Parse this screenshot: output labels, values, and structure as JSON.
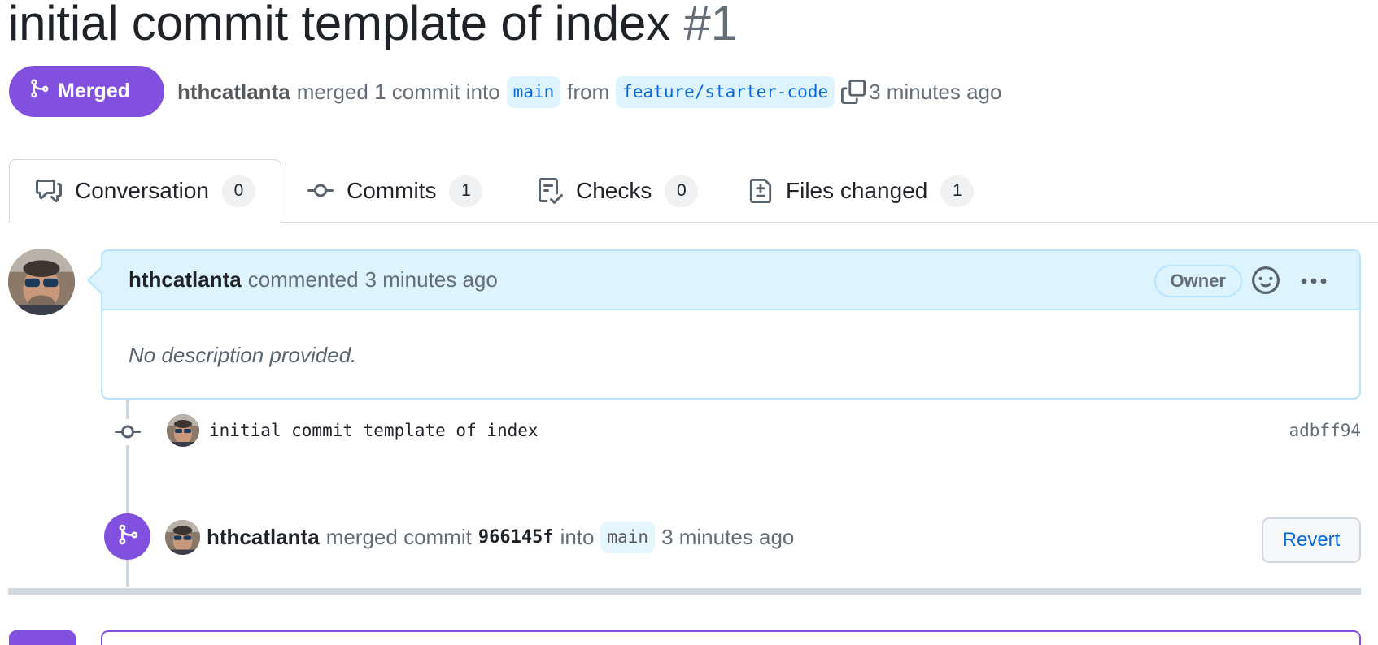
{
  "pr": {
    "title": "initial commit template of index",
    "number": "#1",
    "state": "Merged",
    "author": "hthcatlanta",
    "merge_text": "merged 1 commit into",
    "base_branch": "main",
    "from_text": "from",
    "head_branch": "feature/starter-code",
    "time": "3 minutes ago"
  },
  "tabs": [
    {
      "label": "Conversation",
      "count": "0",
      "icon": "comment-discussion-icon"
    },
    {
      "label": "Commits",
      "count": "1",
      "icon": "git-commit-icon"
    },
    {
      "label": "Checks",
      "count": "0",
      "icon": "checklist-icon"
    },
    {
      "label": "Files changed",
      "count": "1",
      "icon": "file-diff-icon"
    }
  ],
  "comment": {
    "author": "hthcatlanta",
    "action": "commented",
    "time": "3 minutes ago",
    "role_badge": "Owner",
    "body": "No description provided."
  },
  "commit": {
    "message": "initial commit template of index",
    "sha": "adbff94"
  },
  "merge_event": {
    "author": "hthcatlanta",
    "text": "merged commit",
    "sha": "966145f",
    "into_text": "into",
    "branch": "main",
    "time": "3 minutes ago",
    "revert_label": "Revert"
  },
  "colors": {
    "merged_purple": "#8250df",
    "link_blue": "#0969da",
    "comment_header_bg": "#ddf4ff"
  }
}
